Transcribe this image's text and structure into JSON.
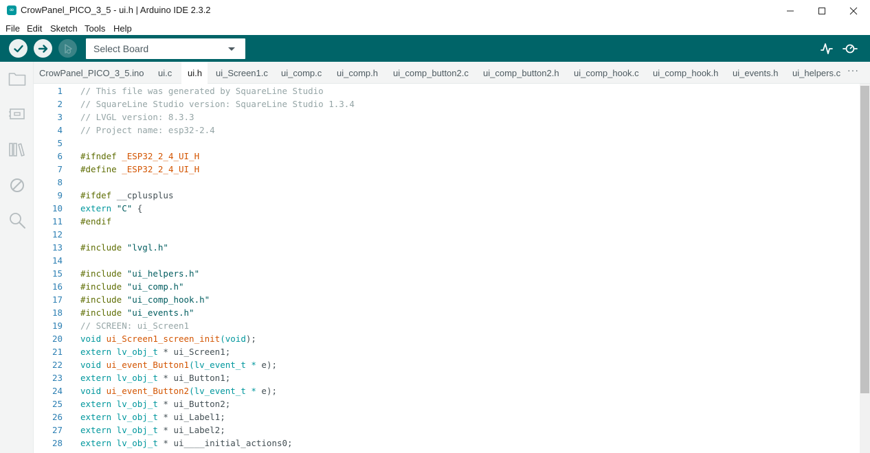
{
  "window": {
    "title": "CrowPanel_PICO_3_5 - ui.h | Arduino IDE 2.3.2",
    "minimize_icon": "minimize-icon",
    "maximize_icon": "maximize-icon",
    "close_icon": "close-icon"
  },
  "menu": [
    "File",
    "Edit",
    "Sketch",
    "Tools",
    "Help"
  ],
  "toolbar": {
    "board_select": "Select Board",
    "verify_icon": "checkmark-icon",
    "upload_icon": "arrow-right-icon",
    "debug_icon": "debug-icon",
    "serial_plotter_icon": "serial-plotter-icon",
    "serial_monitor_icon": "serial-monitor-icon"
  },
  "sidebar": [
    "folder-icon",
    "board-manager-icon",
    "library-icon",
    "debug-disabled-icon",
    "search-icon"
  ],
  "tabs": [
    {
      "label": "CrowPanel_PICO_3_5.ino",
      "active": false
    },
    {
      "label": "ui.c",
      "active": false
    },
    {
      "label": "ui.h",
      "active": true
    },
    {
      "label": "ui_Screen1.c",
      "active": false
    },
    {
      "label": "ui_comp.c",
      "active": false
    },
    {
      "label": "ui_comp.h",
      "active": false
    },
    {
      "label": "ui_comp_button2.c",
      "active": false
    },
    {
      "label": "ui_comp_button2.h",
      "active": false
    },
    {
      "label": "ui_comp_hook.c",
      "active": false
    },
    {
      "label": "ui_comp_hook.h",
      "active": false
    },
    {
      "label": "ui_events.h",
      "active": false
    },
    {
      "label": "ui_helpers.c",
      "active": false
    }
  ],
  "tabs_more": "···",
  "colors": {
    "toolbar": "#006468",
    "accent": "#00979d",
    "comment": "#95a5a6",
    "preprocessor": "#5e6d03",
    "string": "#005c5f",
    "function": "#d35400",
    "line_number": "#2c7fb3"
  },
  "code": [
    {
      "n": "1",
      "t": [
        [
          "c",
          "// This file was generated by SquareLine Studio"
        ]
      ]
    },
    {
      "n": "2",
      "t": [
        [
          "c",
          "// SquareLine Studio version: SquareLine Studio 1.3.4"
        ]
      ]
    },
    {
      "n": "3",
      "t": [
        [
          "c",
          "// LVGL version: 8.3.3"
        ]
      ]
    },
    {
      "n": "4",
      "t": [
        [
          "c",
          "// Project name: esp32-2.4"
        ]
      ]
    },
    {
      "n": "5",
      "t": []
    },
    {
      "n": "6",
      "t": [
        [
          "p",
          "#ifndef "
        ],
        [
          "f",
          "_ESP32_2_4_UI_H"
        ]
      ]
    },
    {
      "n": "7",
      "t": [
        [
          "p",
          "#define "
        ],
        [
          "f",
          "_ESP32_2_4_UI_H"
        ]
      ]
    },
    {
      "n": "8",
      "t": []
    },
    {
      "n": "9",
      "t": [
        [
          "p",
          "#ifdef "
        ],
        [
          "x",
          "__cplusplus"
        ]
      ]
    },
    {
      "n": "10",
      "t": [
        [
          "k",
          "extern "
        ],
        [
          "s",
          "\"C\""
        ],
        [
          "x",
          " {"
        ]
      ]
    },
    {
      "n": "11",
      "t": [
        [
          "p",
          "#endif"
        ]
      ]
    },
    {
      "n": "12",
      "t": []
    },
    {
      "n": "13",
      "t": [
        [
          "p",
          "#include "
        ],
        [
          "s",
          "\"lvgl.h\""
        ]
      ]
    },
    {
      "n": "14",
      "t": []
    },
    {
      "n": "15",
      "t": [
        [
          "p",
          "#include "
        ],
        [
          "s",
          "\"ui_helpers.h\""
        ]
      ]
    },
    {
      "n": "16",
      "t": [
        [
          "p",
          "#include "
        ],
        [
          "s",
          "\"ui_comp.h\""
        ]
      ]
    },
    {
      "n": "17",
      "t": [
        [
          "p",
          "#include "
        ],
        [
          "s",
          "\"ui_comp_hook.h\""
        ]
      ]
    },
    {
      "n": "18",
      "t": [
        [
          "p",
          "#include "
        ],
        [
          "s",
          "\"ui_events.h\""
        ]
      ]
    },
    {
      "n": "19",
      "t": [
        [
          "c",
          "// SCREEN: ui_Screen1"
        ]
      ]
    },
    {
      "n": "20",
      "t": [
        [
          "k",
          "void "
        ],
        [
          "f",
          "ui_Screen1_screen_init"
        ],
        [
          "k",
          "(void"
        ],
        [
          "x",
          ");"
        ]
      ]
    },
    {
      "n": "21",
      "t": [
        [
          "k",
          "extern lv_obj_t "
        ],
        [
          "x",
          "* ui_Screen1;"
        ]
      ]
    },
    {
      "n": "22",
      "t": [
        [
          "k",
          "void "
        ],
        [
          "f",
          "ui_event_Button1"
        ],
        [
          "k",
          "(lv_event_t * "
        ],
        [
          "x",
          "e);"
        ]
      ]
    },
    {
      "n": "23",
      "t": [
        [
          "k",
          "extern lv_obj_t "
        ],
        [
          "x",
          "* ui_Button1;"
        ]
      ]
    },
    {
      "n": "24",
      "t": [
        [
          "k",
          "void "
        ],
        [
          "f",
          "ui_event_Button2"
        ],
        [
          "k",
          "(lv_event_t * "
        ],
        [
          "x",
          "e);"
        ]
      ]
    },
    {
      "n": "25",
      "t": [
        [
          "k",
          "extern lv_obj_t "
        ],
        [
          "x",
          "* ui_Button2;"
        ]
      ]
    },
    {
      "n": "26",
      "t": [
        [
          "k",
          "extern lv_obj_t "
        ],
        [
          "x",
          "* ui_Label1;"
        ]
      ]
    },
    {
      "n": "27",
      "t": [
        [
          "k",
          "extern lv_obj_t "
        ],
        [
          "x",
          "* ui_Label2;"
        ]
      ]
    },
    {
      "n": "28",
      "t": [
        [
          "k",
          "extern lv_obj_t "
        ],
        [
          "x",
          "* ui____initial_actions0;"
        ]
      ]
    }
  ]
}
